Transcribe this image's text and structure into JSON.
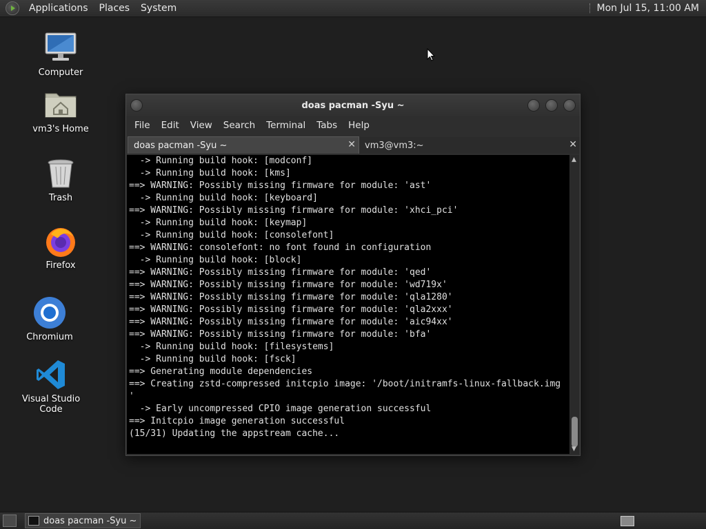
{
  "top_panel": {
    "menus": [
      "Applications",
      "Places",
      "System"
    ],
    "clock": "Mon Jul 15, 11:00 AM"
  },
  "desktop_icons": [
    {
      "label": "Computer",
      "icon": "computer-icon"
    },
    {
      "label": "vm3's Home",
      "icon": "home-folder-icon"
    },
    {
      "label": "Trash",
      "icon": "trash-icon"
    },
    {
      "label": "Firefox",
      "icon": "firefox-icon"
    },
    {
      "label": "Chromium",
      "icon": "chromium-icon"
    },
    {
      "label": "Visual Studio Code",
      "icon": "vscode-icon"
    }
  ],
  "terminal": {
    "title": "doas pacman -Syu ~",
    "menu": [
      "File",
      "Edit",
      "View",
      "Search",
      "Terminal",
      "Tabs",
      "Help"
    ],
    "tabs": [
      {
        "label": "doas pacman -Syu ~",
        "active": true
      },
      {
        "label": "vm3@vm3:~",
        "active": false
      }
    ],
    "lines": [
      "  -> Running build hook: [modconf]",
      "  -> Running build hook: [kms]",
      "==> WARNING: Possibly missing firmware for module: 'ast'",
      "  -> Running build hook: [keyboard]",
      "==> WARNING: Possibly missing firmware for module: 'xhci_pci'",
      "  -> Running build hook: [keymap]",
      "  -> Running build hook: [consolefont]",
      "==> WARNING: consolefont: no font found in configuration",
      "  -> Running build hook: [block]",
      "==> WARNING: Possibly missing firmware for module: 'qed'",
      "==> WARNING: Possibly missing firmware for module: 'wd719x'",
      "==> WARNING: Possibly missing firmware for module: 'qla1280'",
      "==> WARNING: Possibly missing firmware for module: 'qla2xxx'",
      "==> WARNING: Possibly missing firmware for module: 'aic94xx'",
      "==> WARNING: Possibly missing firmware for module: 'bfa'",
      "  -> Running build hook: [filesystems]",
      "  -> Running build hook: [fsck]",
      "==> Generating module dependencies",
      "==> Creating zstd-compressed initcpio image: '/boot/initramfs-linux-fallback.img",
      "'",
      "  -> Early uncompressed CPIO image generation successful",
      "==> Initcpio image generation successful",
      "(15/31) Updating the appstream cache..."
    ]
  },
  "taskbar": {
    "window_button": "doas pacman -Syu ~"
  }
}
